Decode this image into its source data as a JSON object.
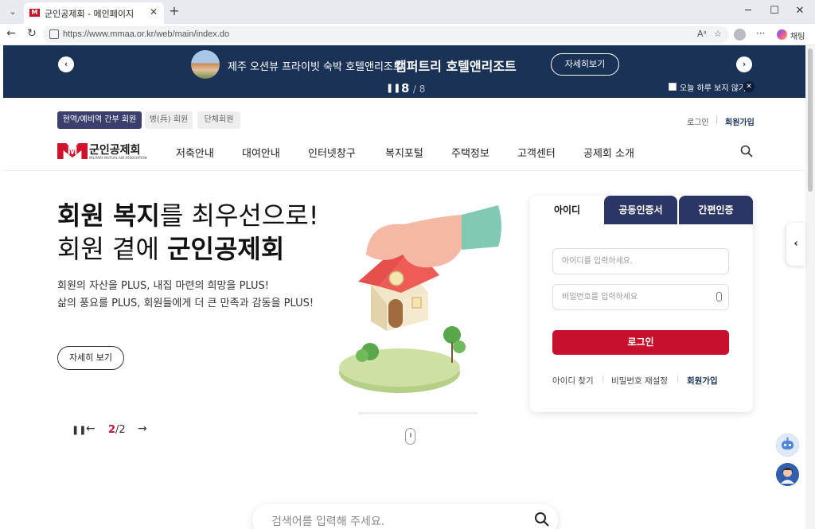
{
  "browser": {
    "tab_title": "군인공제회 - 메인페이지",
    "url": "https://www.mmaa.or.kr/web/main/index.do",
    "chat_label": "채팅",
    "icons": [
      "tab-list-icon",
      "favicon-icon",
      "close-icon",
      "new-tab-icon",
      "minimize-icon",
      "maximize-icon",
      "window-close-icon",
      "back-icon",
      "refresh-icon",
      "read-aloud-icon",
      "favorite-icon",
      "profile-icon",
      "more-icon",
      "copilot-icon"
    ]
  },
  "banner": {
    "subtitle": "제주 오션뷰 프라이빗 숙박 호텔앤리조트",
    "title": "캠퍼트리 호텔앤리조트",
    "more_label": "자세히보기",
    "current": "8",
    "total": "/ 8",
    "today_label": "오늘 하루 보지 않기",
    "bg_color": "#1b3257"
  },
  "header": {
    "member_tabs": [
      "현역/예비역 간부 회원",
      "병(兵) 회원",
      "단체회원"
    ],
    "login": "로그인",
    "join": "회원가입",
    "logo_text": "군인공제회",
    "logo_eng": "MILITARY MUTUAL AID ASSOCIATION",
    "nav": [
      "저축안내",
      "대여안내",
      "인터넷창구",
      "복지포털",
      "주택정보",
      "고객센터",
      "공제회 소개"
    ]
  },
  "hero": {
    "line1_bold": "회원 복지",
    "line1_rest": "를 최우선으로!",
    "line2_rest": "회원 곁에 ",
    "line2_bold": "군인공제회",
    "desc1": "회원의 자산을 PLUS, 내집 마련의 희망을 PLUS!",
    "desc2": "삶의 풍요를 PLUS, 회원들에게 더 큰 만족과 감동을 PLUS!",
    "more_label": "자세히 보기",
    "current": "2",
    "total": "/2"
  },
  "login_box": {
    "tabs": [
      "아이디",
      "공동인증서",
      "간편인증"
    ],
    "id_placeholder": "아이디를 입력하세요.",
    "pw_placeholder": "비밀번호를 입력하세요",
    "login_button": "로그인",
    "find_id": "아이디 찾기",
    "reset_pw": "비밀번호 재설정",
    "join": "회원가입",
    "accent": "#c8102e"
  },
  "bottom_search": {
    "placeholder": "검색어를 입력해 주세요."
  }
}
